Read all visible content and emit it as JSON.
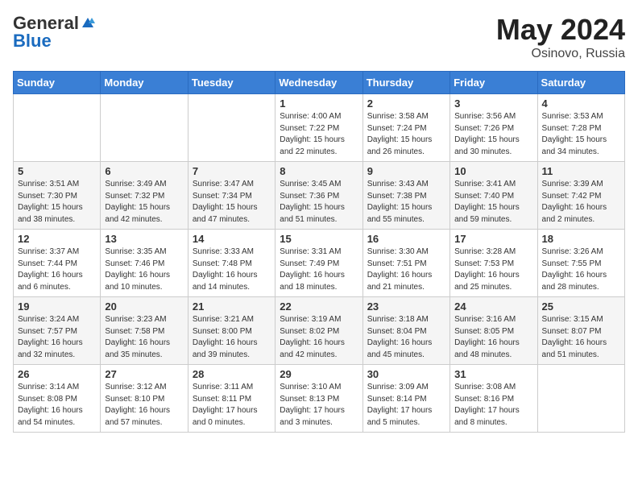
{
  "header": {
    "logo_general": "General",
    "logo_blue": "Blue",
    "month_year": "May 2024",
    "location": "Osinovo, Russia"
  },
  "days_of_week": [
    "Sunday",
    "Monday",
    "Tuesday",
    "Wednesday",
    "Thursday",
    "Friday",
    "Saturday"
  ],
  "weeks": [
    [
      {
        "day": "",
        "sunrise": "",
        "sunset": "",
        "daylight": ""
      },
      {
        "day": "",
        "sunrise": "",
        "sunset": "",
        "daylight": ""
      },
      {
        "day": "",
        "sunrise": "",
        "sunset": "",
        "daylight": ""
      },
      {
        "day": "1",
        "sunrise": "Sunrise: 4:00 AM",
        "sunset": "Sunset: 7:22 PM",
        "daylight": "Daylight: 15 hours and 22 minutes."
      },
      {
        "day": "2",
        "sunrise": "Sunrise: 3:58 AM",
        "sunset": "Sunset: 7:24 PM",
        "daylight": "Daylight: 15 hours and 26 minutes."
      },
      {
        "day": "3",
        "sunrise": "Sunrise: 3:56 AM",
        "sunset": "Sunset: 7:26 PM",
        "daylight": "Daylight: 15 hours and 30 minutes."
      },
      {
        "day": "4",
        "sunrise": "Sunrise: 3:53 AM",
        "sunset": "Sunset: 7:28 PM",
        "daylight": "Daylight: 15 hours and 34 minutes."
      }
    ],
    [
      {
        "day": "5",
        "sunrise": "Sunrise: 3:51 AM",
        "sunset": "Sunset: 7:30 PM",
        "daylight": "Daylight: 15 hours and 38 minutes."
      },
      {
        "day": "6",
        "sunrise": "Sunrise: 3:49 AM",
        "sunset": "Sunset: 7:32 PM",
        "daylight": "Daylight: 15 hours and 42 minutes."
      },
      {
        "day": "7",
        "sunrise": "Sunrise: 3:47 AM",
        "sunset": "Sunset: 7:34 PM",
        "daylight": "Daylight: 15 hours and 47 minutes."
      },
      {
        "day": "8",
        "sunrise": "Sunrise: 3:45 AM",
        "sunset": "Sunset: 7:36 PM",
        "daylight": "Daylight: 15 hours and 51 minutes."
      },
      {
        "day": "9",
        "sunrise": "Sunrise: 3:43 AM",
        "sunset": "Sunset: 7:38 PM",
        "daylight": "Daylight: 15 hours and 55 minutes."
      },
      {
        "day": "10",
        "sunrise": "Sunrise: 3:41 AM",
        "sunset": "Sunset: 7:40 PM",
        "daylight": "Daylight: 15 hours and 59 minutes."
      },
      {
        "day": "11",
        "sunrise": "Sunrise: 3:39 AM",
        "sunset": "Sunset: 7:42 PM",
        "daylight": "Daylight: 16 hours and 2 minutes."
      }
    ],
    [
      {
        "day": "12",
        "sunrise": "Sunrise: 3:37 AM",
        "sunset": "Sunset: 7:44 PM",
        "daylight": "Daylight: 16 hours and 6 minutes."
      },
      {
        "day": "13",
        "sunrise": "Sunrise: 3:35 AM",
        "sunset": "Sunset: 7:46 PM",
        "daylight": "Daylight: 16 hours and 10 minutes."
      },
      {
        "day": "14",
        "sunrise": "Sunrise: 3:33 AM",
        "sunset": "Sunset: 7:48 PM",
        "daylight": "Daylight: 16 hours and 14 minutes."
      },
      {
        "day": "15",
        "sunrise": "Sunrise: 3:31 AM",
        "sunset": "Sunset: 7:49 PM",
        "daylight": "Daylight: 16 hours and 18 minutes."
      },
      {
        "day": "16",
        "sunrise": "Sunrise: 3:30 AM",
        "sunset": "Sunset: 7:51 PM",
        "daylight": "Daylight: 16 hours and 21 minutes."
      },
      {
        "day": "17",
        "sunrise": "Sunrise: 3:28 AM",
        "sunset": "Sunset: 7:53 PM",
        "daylight": "Daylight: 16 hours and 25 minutes."
      },
      {
        "day": "18",
        "sunrise": "Sunrise: 3:26 AM",
        "sunset": "Sunset: 7:55 PM",
        "daylight": "Daylight: 16 hours and 28 minutes."
      }
    ],
    [
      {
        "day": "19",
        "sunrise": "Sunrise: 3:24 AM",
        "sunset": "Sunset: 7:57 PM",
        "daylight": "Daylight: 16 hours and 32 minutes."
      },
      {
        "day": "20",
        "sunrise": "Sunrise: 3:23 AM",
        "sunset": "Sunset: 7:58 PM",
        "daylight": "Daylight: 16 hours and 35 minutes."
      },
      {
        "day": "21",
        "sunrise": "Sunrise: 3:21 AM",
        "sunset": "Sunset: 8:00 PM",
        "daylight": "Daylight: 16 hours and 39 minutes."
      },
      {
        "day": "22",
        "sunrise": "Sunrise: 3:19 AM",
        "sunset": "Sunset: 8:02 PM",
        "daylight": "Daylight: 16 hours and 42 minutes."
      },
      {
        "day": "23",
        "sunrise": "Sunrise: 3:18 AM",
        "sunset": "Sunset: 8:04 PM",
        "daylight": "Daylight: 16 hours and 45 minutes."
      },
      {
        "day": "24",
        "sunrise": "Sunrise: 3:16 AM",
        "sunset": "Sunset: 8:05 PM",
        "daylight": "Daylight: 16 hours and 48 minutes."
      },
      {
        "day": "25",
        "sunrise": "Sunrise: 3:15 AM",
        "sunset": "Sunset: 8:07 PM",
        "daylight": "Daylight: 16 hours and 51 minutes."
      }
    ],
    [
      {
        "day": "26",
        "sunrise": "Sunrise: 3:14 AM",
        "sunset": "Sunset: 8:08 PM",
        "daylight": "Daylight: 16 hours and 54 minutes."
      },
      {
        "day": "27",
        "sunrise": "Sunrise: 3:12 AM",
        "sunset": "Sunset: 8:10 PM",
        "daylight": "Daylight: 16 hours and 57 minutes."
      },
      {
        "day": "28",
        "sunrise": "Sunrise: 3:11 AM",
        "sunset": "Sunset: 8:11 PM",
        "daylight": "Daylight: 17 hours and 0 minutes."
      },
      {
        "day": "29",
        "sunrise": "Sunrise: 3:10 AM",
        "sunset": "Sunset: 8:13 PM",
        "daylight": "Daylight: 17 hours and 3 minutes."
      },
      {
        "day": "30",
        "sunrise": "Sunrise: 3:09 AM",
        "sunset": "Sunset: 8:14 PM",
        "daylight": "Daylight: 17 hours and 5 minutes."
      },
      {
        "day": "31",
        "sunrise": "Sunrise: 3:08 AM",
        "sunset": "Sunset: 8:16 PM",
        "daylight": "Daylight: 17 hours and 8 minutes."
      },
      {
        "day": "",
        "sunrise": "",
        "sunset": "",
        "daylight": ""
      }
    ]
  ]
}
